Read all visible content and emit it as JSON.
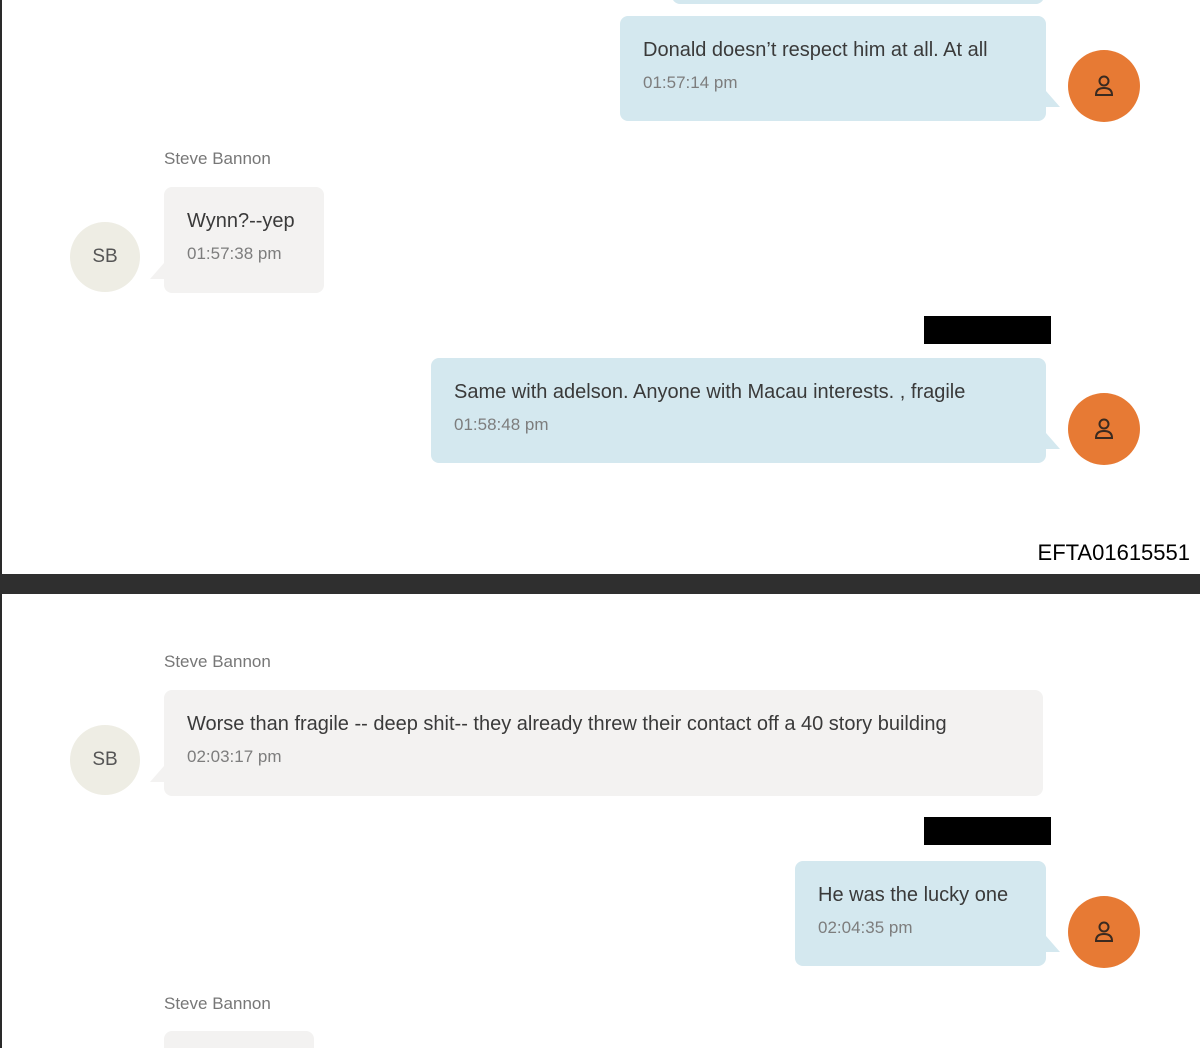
{
  "messages_page1": [
    {
      "text": "Donald doesn’t respect him at all.  At all",
      "time": "01:57:14 pm"
    },
    {
      "sender": "Steve Bannon",
      "initials": "SB",
      "text": "Wynn?--yep",
      "time": "01:57:38 pm"
    },
    {
      "text": "Same with adelson.   Anyone with Macau interests. ,  fragile",
      "time": "01:58:48 pm"
    }
  ],
  "page_id": "EFTA01615551",
  "messages_page2": [
    {
      "sender": "Steve Bannon",
      "initials": "SB",
      "text": "Worse than fragile -- deep shit-- they already threw their contact off a 40 story building",
      "time": "02:03:17 pm"
    },
    {
      "text": "He was the lucky one",
      "time": "02:04:35 pm"
    },
    {
      "sender": "Steve Bannon"
    }
  ],
  "icons": {
    "self_avatar": "person-icon",
    "redaction": "redaction-bar"
  },
  "colors": {
    "incoming_bubble": "#f3f2f1",
    "outgoing_bubble": "#d4e8ef",
    "self_avatar": "#e77a34",
    "contact_avatar": "#eeede4"
  }
}
